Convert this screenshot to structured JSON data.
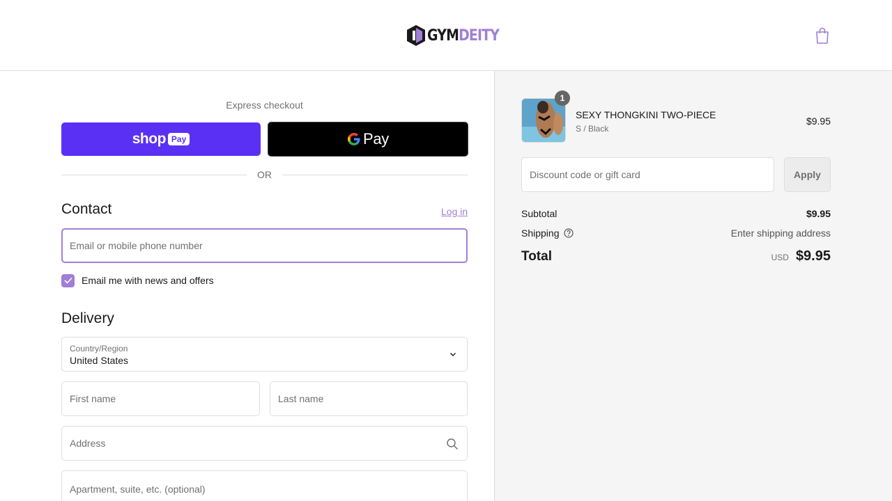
{
  "header": {
    "brand_left": "GYM",
    "brand_right": "DEITY",
    "cart_icon": "shopping-bag-icon"
  },
  "express": {
    "title": "Express checkout",
    "shoppay_word": "shop",
    "shoppay_pill": "Pay",
    "gpay_text": "Pay",
    "or_text": "OR"
  },
  "contact": {
    "heading": "Contact",
    "login_label": "Log in",
    "email_placeholder": "Email or mobile phone number",
    "newsletter_label": "Email me with news and offers",
    "newsletter_checked": true
  },
  "delivery": {
    "heading": "Delivery",
    "country_label": "Country/Region",
    "country_value": "United States",
    "first_name_placeholder": "First name",
    "last_name_placeholder": "Last name",
    "address_placeholder": "Address",
    "apartment_placeholder": "Apartment, suite, etc. (optional)"
  },
  "summary": {
    "item": {
      "quantity": "1",
      "name": "SEXY THONGKINI TWO-PIECE",
      "variant": "S / Black",
      "price": "$9.95"
    },
    "discount_placeholder": "Discount code or gift card",
    "apply_label": "Apply",
    "subtotal_label": "Subtotal",
    "subtotal_value": "$9.95",
    "shipping_label": "Shipping",
    "shipping_value": "Enter shipping address",
    "total_label": "Total",
    "currency": "USD",
    "total_value": "$9.95"
  },
  "colors": {
    "accent": "#a07fd6",
    "shoppay": "#5a31f4",
    "summary_bg": "#f5f5f5"
  }
}
